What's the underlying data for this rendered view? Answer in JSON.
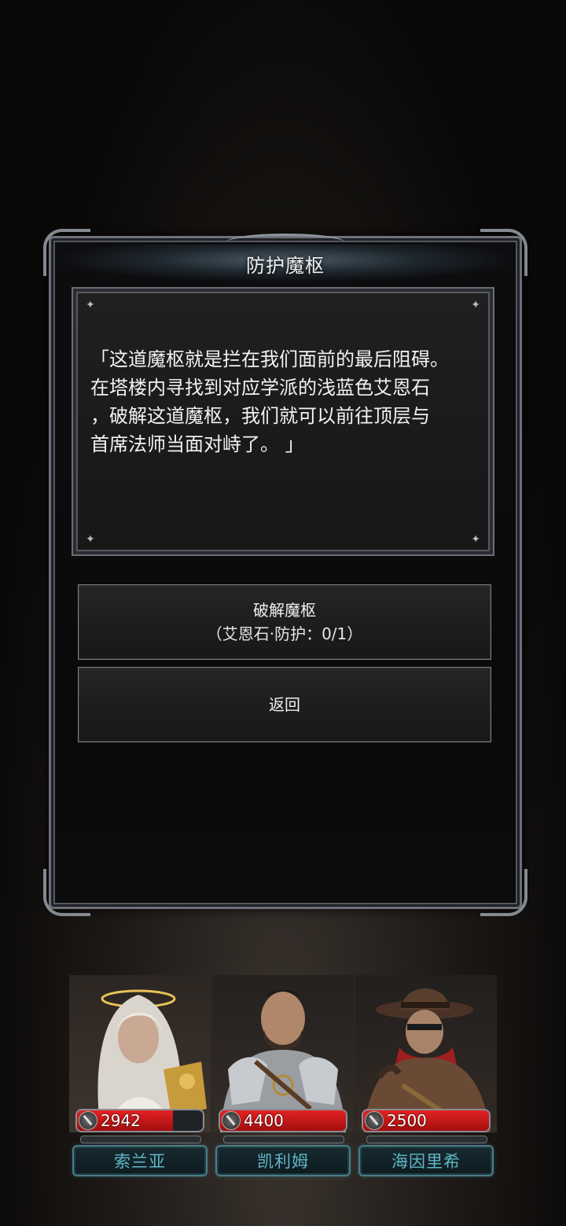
{
  "dialog": {
    "title": "防护魔枢",
    "story_text": "「这道魔枢就是拦在我们面前的最后阻碍。\n在塔楼内寻找到对应学派的浅蓝色艾恩石\n，破解这道魔枢，我们就可以前往顶层与\n首席法师当面对峙了。 」"
  },
  "buttons": {
    "break_label": "破解魔枢",
    "break_requirement": "（艾恩石·防护：0/1）",
    "back_label": "返回"
  },
  "party": [
    {
      "name": "索兰亚",
      "hp": "2942",
      "hp_fraction": 0.76
    },
    {
      "name": "凯利姆",
      "hp": "4400",
      "hp_fraction": 1.0
    },
    {
      "name": "海因里希",
      "hp": "2500",
      "hp_fraction": 1.0
    }
  ],
  "colors": {
    "hp_red": "#e32222",
    "name_cyan": "#5fb7c7",
    "frame_silver": "#6c7078"
  },
  "icons": {
    "hp": "sword-icon",
    "corner_decor": "sparkle-icon"
  }
}
